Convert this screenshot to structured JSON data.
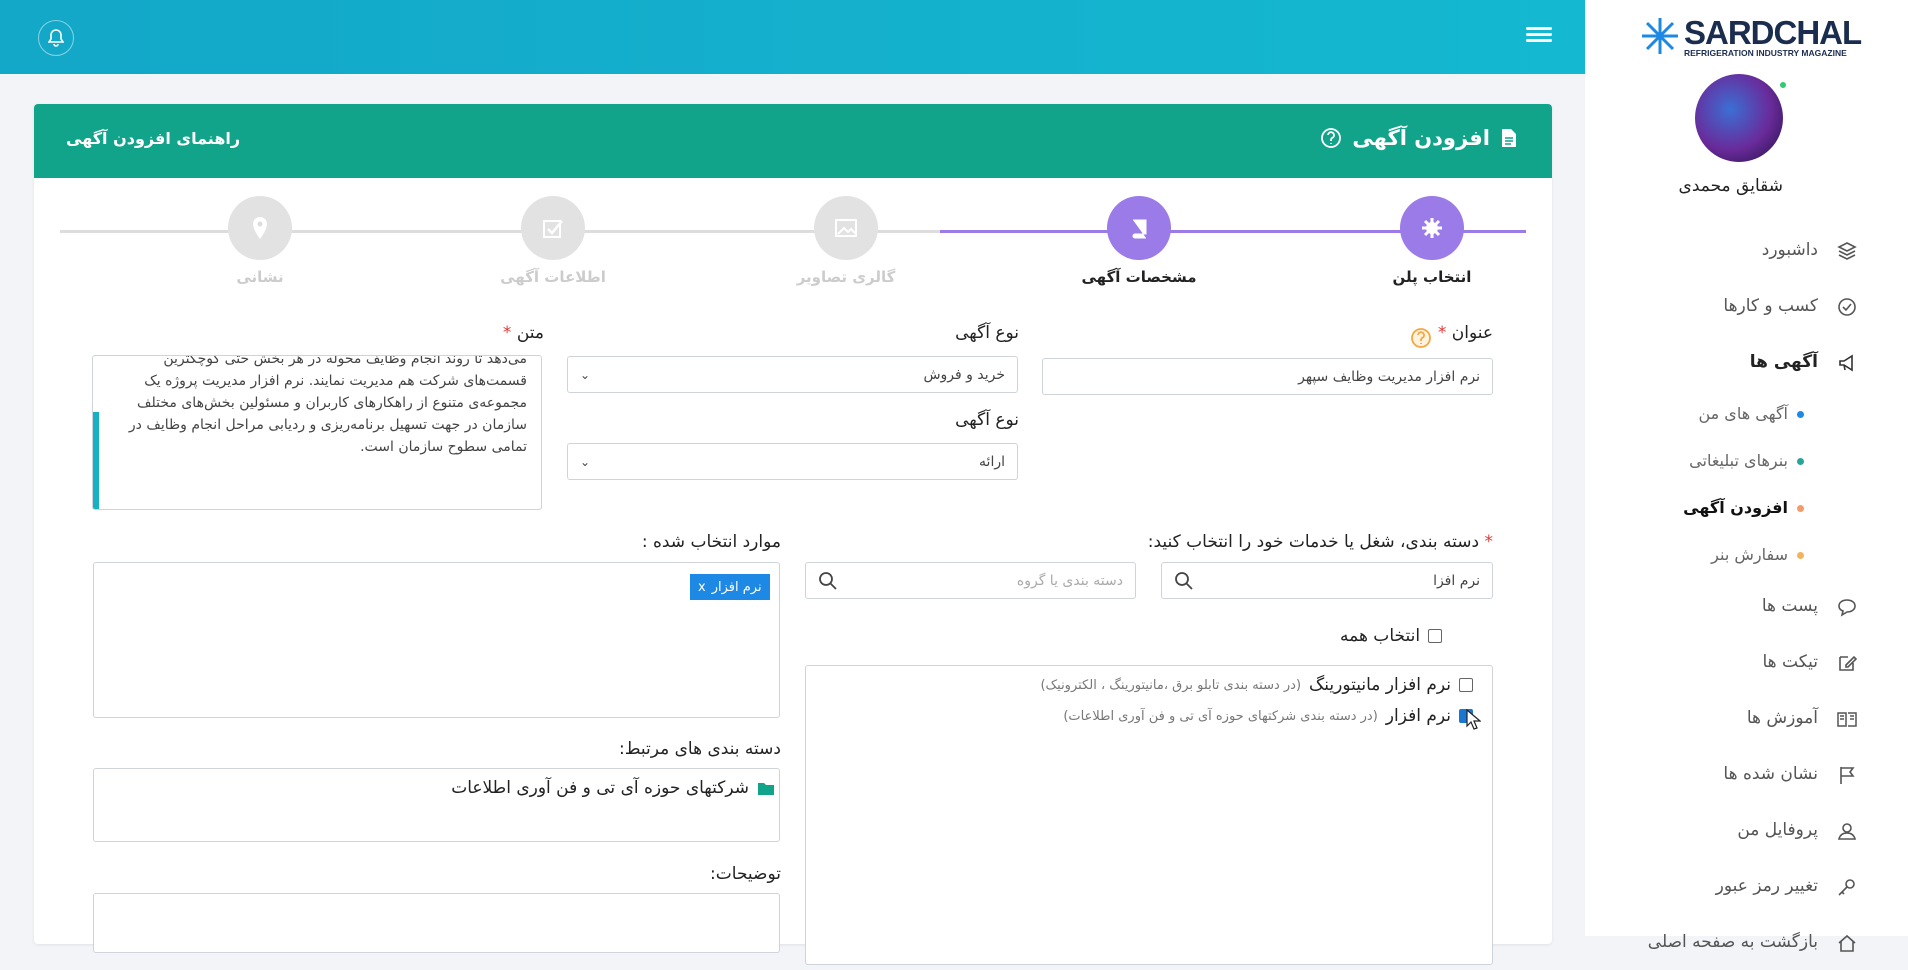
{
  "topbar": {
    "bell_icon": "bell-icon",
    "menu_icon": "menu-icon"
  },
  "brand": {
    "logo_text": "SARDCHAL",
    "logo_sub": "REFRIGERATION INDUSTRY MAGAZINE"
  },
  "user": {
    "name": "شقایق محمدی"
  },
  "sidebar": {
    "items": [
      {
        "label": "داشبورد",
        "icon": "layers-icon"
      },
      {
        "label": "کسب و کارها",
        "icon": "check-circle-icon"
      },
      {
        "label": "آگهی ها",
        "icon": "megaphone-icon"
      },
      {
        "label": "پست ها",
        "icon": "chat-icon"
      },
      {
        "label": "تیکت ها",
        "icon": "edit-icon"
      },
      {
        "label": "آموزش ها",
        "icon": "book-icon"
      },
      {
        "label": "نشان شده ها",
        "icon": "flag-icon"
      },
      {
        "label": "پروفایل من",
        "icon": "user-icon"
      },
      {
        "label": "تغییر رمز عبور",
        "icon": "key-icon"
      },
      {
        "label": "بازگشت به صفحه اصلی",
        "icon": "home-icon"
      }
    ],
    "sub_items": [
      {
        "label": "آگهی های من",
        "dot": "#1e88e5"
      },
      {
        "label": "بنرهای تبلیغاتی",
        "dot": "#26a69a"
      },
      {
        "label": "افزودن آگهی",
        "dot": "#f39c6b"
      },
      {
        "label": "سفارش بنر",
        "dot": "#f3b35a"
      }
    ]
  },
  "card": {
    "title": "افزودن آگهی",
    "guide": "راهنمای افزودن آگهی"
  },
  "steps": [
    {
      "label": "انتخاب پلن",
      "state": "done"
    },
    {
      "label": "مشخصات آگهی",
      "state": "done"
    },
    {
      "label": "گالری تصاویر",
      "state": "todo"
    },
    {
      "label": "اطلاعات آگهی",
      "state": "todo"
    },
    {
      "label": "نشانی",
      "state": "todo"
    }
  ],
  "form": {
    "title_label": "عنوان",
    "title_value": "نرم افزار مدیریت وظایف سپهر",
    "type_label": "نوع آگهی",
    "type_value": "خرید و فروش",
    "type2_label": "نوع آگهی",
    "type2_value": "ارائه",
    "text_label": "متن",
    "text_lines": [
      "می‌دهد تا روند انجام وظایف محوله در هر بخش حتی کوچکترین",
      "قسمت‌های شرکت هم مدیریت نمایند. نرم افزار مدیریت پروژه یک",
      "مجموعه‌ی متنوع از راهکارهای کاربران و مسئولین بخش‌های مختلف",
      "سازمان در جهت تسهیل برنامه‌ریزی و ردیابی مراحل انجام وظایف در",
      "تمامی سطوح سازمان است."
    ],
    "category_label": "دسته بندی، شغل یا خدمات خود را انتخاب کنید:",
    "search_value": "نرم افزا",
    "group_placeholder": "دسته بندی یا گروه",
    "selected_label": "موارد انتخاب شده :",
    "chip_label": "نرم افزار",
    "chip_x": "x",
    "select_all": "انتخاب همه",
    "options": [
      {
        "name": "نرم افزار مانیتورینگ",
        "note": "(در دسته بندی تابلو برق ،مانیتورینگ ، الکترونیک)",
        "checked": false
      },
      {
        "name": "نرم افزار",
        "note": "(در دسته بندی شرکتهای حوزه آی تی و فن آوری اطلاعات)",
        "checked": true
      }
    ],
    "related_label": "دسته بندی های مرتبط:",
    "related_value": "شرکتهای حوزه آی تی و فن آوری اطلاعات",
    "desc_label": "توضیحات:"
  },
  "colors": {
    "topbar": "#14b0cc",
    "header": "#12a48b",
    "step_active": "#9a7be8",
    "chip": "#1e88e5"
  }
}
